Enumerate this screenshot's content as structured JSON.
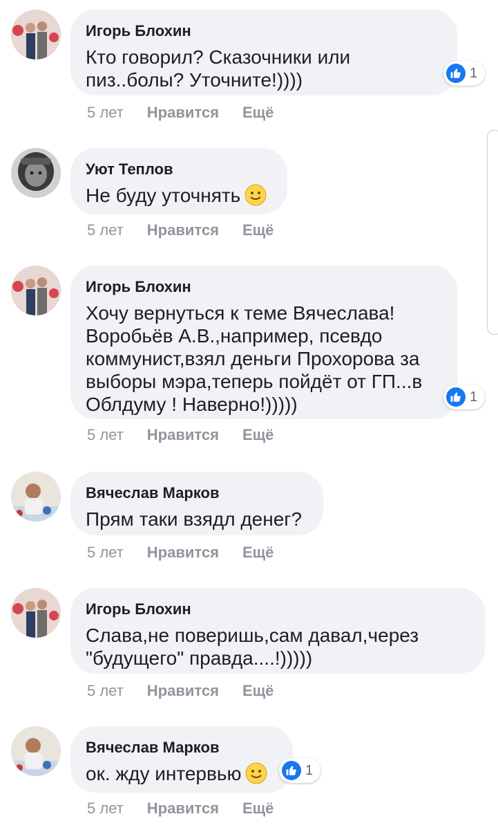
{
  "comments": [
    {
      "author": "Игорь Блохин",
      "text": "Кто говорил? Сказочники или пиз..болы? Уточните!))))",
      "time": "5 лет",
      "like": "Нравится",
      "more": "Ещё",
      "reactions": "1"
    },
    {
      "author": "Уют Теплов",
      "text": "Не буду уточнять",
      "time": "5 лет",
      "like": "Нравится",
      "more": "Ещё"
    },
    {
      "author": "Игорь Блохин",
      "text": "Хочу вернуться к теме Вячеслава! Воробьёв А.В.,например, псевдо коммунист,взял деньги Прохорова за выборы мэра,теперь пойдёт от ГП...в Облдуму ! Наверно!)))))",
      "time": "5 лет",
      "like": "Нравится",
      "more": "Ещё",
      "reactions": "1"
    },
    {
      "author": "Вячеслав Марков",
      "text": "Прям таки взядл денег?",
      "time": "5 лет",
      "like": "Нравится",
      "more": "Ещё"
    },
    {
      "author": "Игорь Блохин",
      "text": "Слава,не поверишь,сам давал,через \"будущего\" правда....!)))))",
      "time": "5 лет",
      "like": "Нравится",
      "more": "Ещё"
    },
    {
      "author": "Вячеслав Марков",
      "text": "ок. жду интервью",
      "time": "5 лет",
      "like": "Нравится",
      "more": "Ещё",
      "reactions": "1"
    }
  ],
  "colors": {
    "bubble": "#f0f2f5",
    "like_blue": "#1877f2",
    "meta_gray": "#90949c"
  },
  "icons": {
    "like": "thumbs-up-icon",
    "emoji": "smiley-icon"
  }
}
